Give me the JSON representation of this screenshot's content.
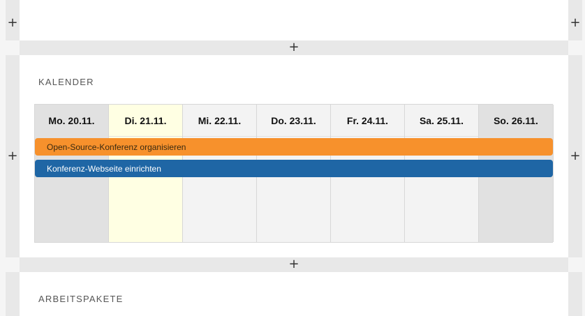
{
  "sections": {
    "calendar_title": "KALENDER",
    "workpackages_title": "ARBEITSPAKETE"
  },
  "icons": {
    "add": "+"
  },
  "calendar": {
    "days": [
      {
        "label": "Mo. 20.11.",
        "kind": "weekend"
      },
      {
        "label": "Di. 21.11.",
        "kind": "today"
      },
      {
        "label": "Mi. 22.11.",
        "kind": "weekday"
      },
      {
        "label": "Do. 23.11.",
        "kind": "weekday"
      },
      {
        "label": "Fr. 24.11.",
        "kind": "weekday"
      },
      {
        "label": "Sa. 25.11.",
        "kind": "weekday"
      },
      {
        "label": "So. 26.11.",
        "kind": "weekend"
      }
    ],
    "events": [
      {
        "title": "Open-Source-Konferenz organisieren",
        "color": "#f7912c",
        "text_color": "#3a2a10"
      },
      {
        "title": "Konferenz-Webseite einrichten",
        "color": "#1f66a5",
        "text_color": "#ffffff"
      }
    ]
  },
  "colors": {
    "weekend_bg": "#e1e1e1",
    "today_bg": "#ffffe3",
    "weekday_bg": "#f3f3f3"
  }
}
